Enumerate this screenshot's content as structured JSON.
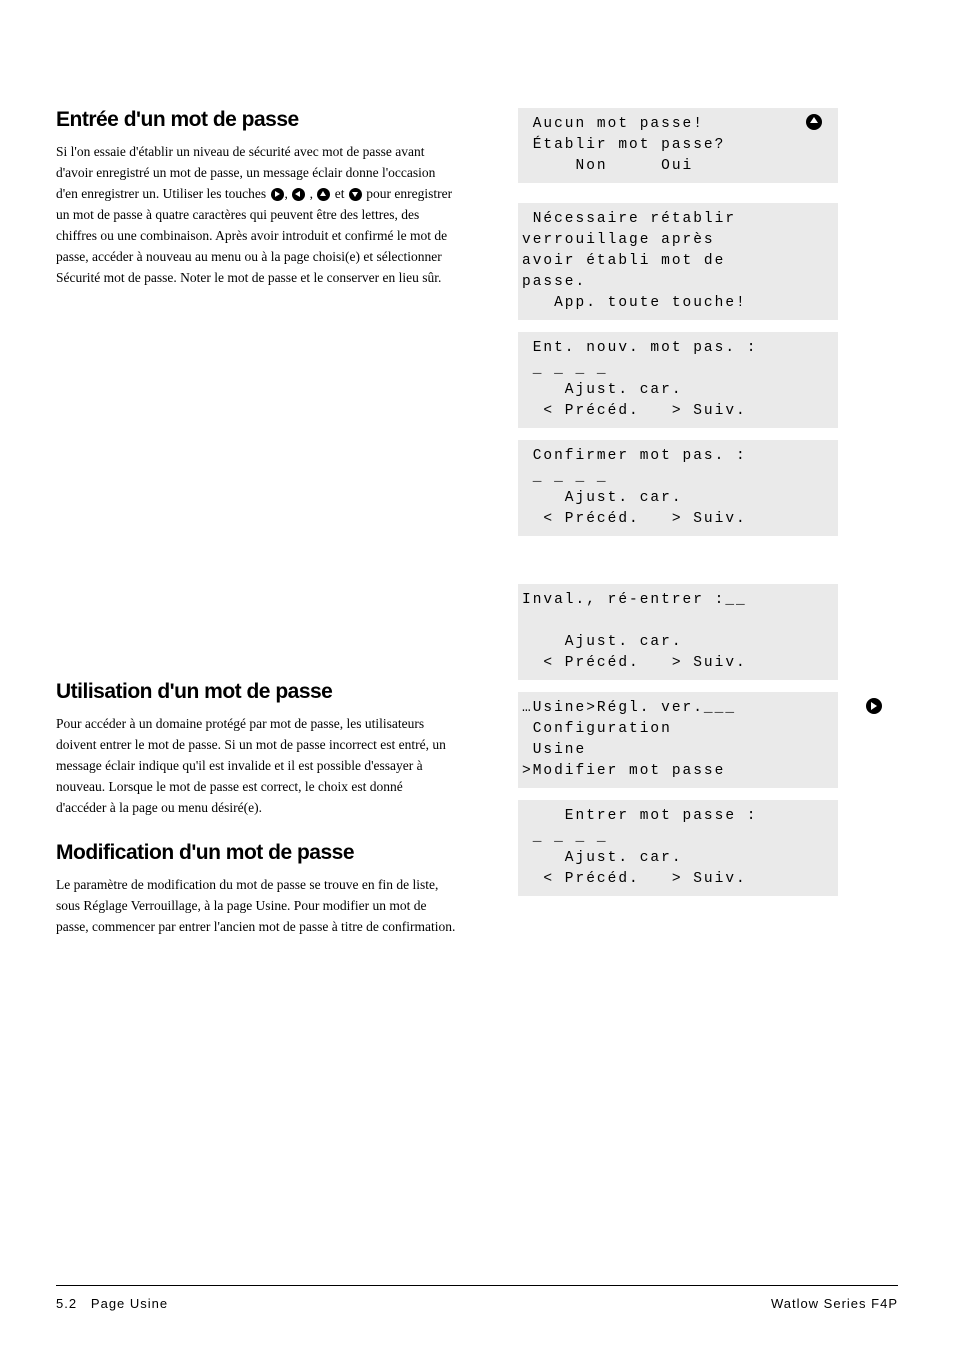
{
  "section1": {
    "heading": "Entrée d'un mot de passe",
    "p1a": "Si l'on essaie d'établir un niveau de sécurité avec mot de passe avant d'avoir enregistré un mot de passe, un message éclair donne l'occasion d'en enregistrer un. Utiliser les touches ",
    "p1b": " pour enregistrer un mot de passe à quatre caractères qui peuvent être des lettres, des chiffres ou une combinaison. Après avoir introduit et confirmé le mot de passe, accéder à nouveau au menu ou à la page choisi(e) et sélectionner Sécurité mot de passe. Noter le mot de passe et le conserver en lieu sûr.",
    "sep1": ", ",
    "sep2": " , ",
    "sep3": "  et "
  },
  "section2": {
    "heading": "Utilisation d'un mot de passe",
    "p1": "Pour accéder à un domaine protégé par mot de passe, les utilisateurs doivent entrer le mot de passe. Si un mot de passe incorrect est entré, un message éclair indique qu'il est invalide et il est possible d'essayer à nouveau. Lorsque le mot de passe est correct, le choix est donné d'accéder à la page ou menu désiré(e)."
  },
  "section3": {
    "heading": "Modification d'un mot de passe",
    "p1": "Le paramètre de modification du mot de passe se trouve en fin de liste, sous Réglage Verrouillage, à la page Usine. Pour modifier un mot de passe, commencer par entrer l'ancien mot de passe à titre de confirmation."
  },
  "screens": {
    "s1": " Aucun mot passe!\n Établir mot passe?\n     Non     Oui",
    "s2": " Nécessaire rétablir\nverrouillage après\navoir établi mot de\npasse.\n   App. toute touche!",
    "s3": " Ent. nouv. mot pas. :\n _ _ _ _\n    Ajust. car.\n  < Précéd.   > Suiv.",
    "s4": " Confirmer mot pas. :\n _ _ _ _\n    Ajust. car.\n  < Précéd.   > Suiv.",
    "s5": "Inval., ré-entrer :__\n\n    Ajust. car.\n  < Précéd.   > Suiv.",
    "s6": "…Usine>Régl. ver.___\n Configuration\n Usine\n>Modifier mot passe",
    "s7": "    Entrer mot passe :\n _ _ _ _\n    Ajust. car.\n  < Précéd.   > Suiv."
  },
  "footer": {
    "left_num": "5.2",
    "left_text": "Page Usine",
    "right": "Watlow Series F4P"
  }
}
